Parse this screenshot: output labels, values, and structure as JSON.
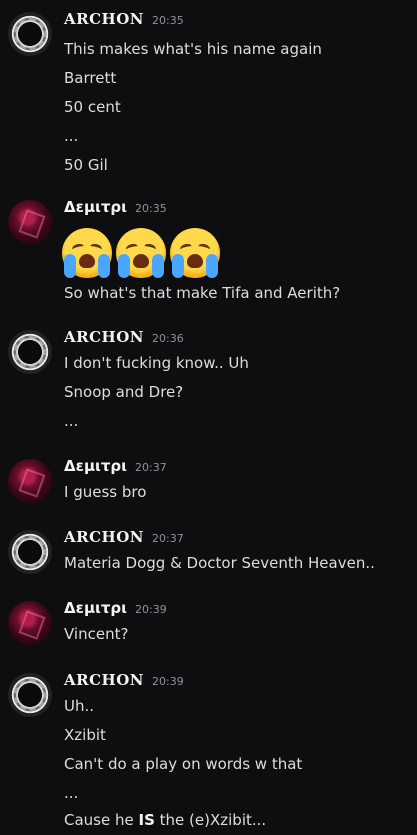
{
  "messages": [
    {
      "author": "ARCHON",
      "time": "20:35",
      "lines": [
        "This makes what's his name again",
        "Barrett",
        "50 cent",
        "...",
        "50 Gil"
      ]
    },
    {
      "author": "Δεμιτρι",
      "time": "20:35",
      "emoji": [
        "loudly-crying-face",
        "loudly-crying-face",
        "loudly-crying-face"
      ],
      "lines": [
        "So what's that make Tifa and Aerith?"
      ]
    },
    {
      "author": "ARCHON",
      "time": "20:36",
      "lines": [
        "I don't fucking know.. Uh",
        "Snoop and Dre?",
        "..."
      ]
    },
    {
      "author": "Δεμιτρι",
      "time": "20:37",
      "lines": [
        "I guess bro"
      ]
    },
    {
      "author": "ARCHON",
      "time": "20:37",
      "lines": [
        "Materia Dogg & Doctor Seventh Heaven.."
      ]
    },
    {
      "author": "Δεμιτρι",
      "time": "20:39",
      "lines": [
        "Vincent?"
      ]
    },
    {
      "author": "ARCHON",
      "time": "20:39",
      "lines": [
        "Uh..",
        "Xzibit",
        "Can't do a play on words w that",
        "...",
        "Cause he ",
        "IS",
        " the (e)Xzibit..."
      ]
    }
  ]
}
